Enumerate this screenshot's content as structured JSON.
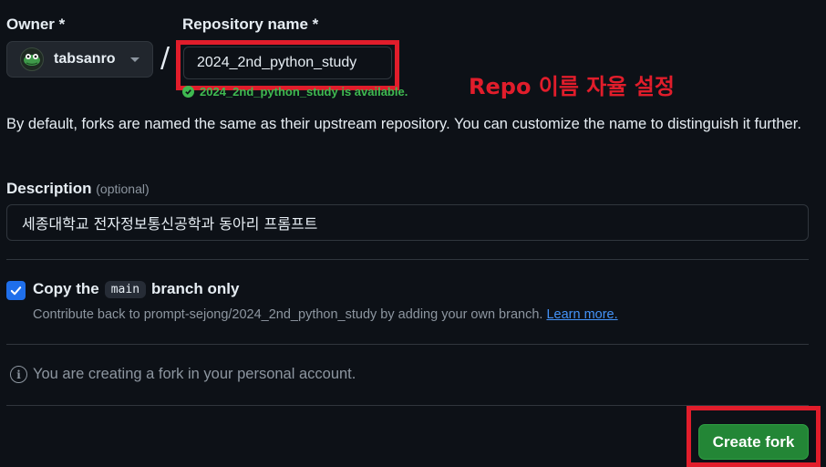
{
  "form": {
    "owner_label": "Owner *",
    "owner_name": "tabsanro",
    "separator": "/",
    "repo_label": "Repository name *",
    "repo_value": "2024_2nd_python_study",
    "availability": "2024_2nd_python_study is available.",
    "hint": "By default, forks are named the same as their upstream repository. You can customize the name to distinguish it further.",
    "description_label": "Description",
    "description_optional": "(optional)",
    "description_value": "세종대학교 전자정보통신공학과 동아리 프롬프트",
    "copy_prefix": "Copy the",
    "copy_branch": "main",
    "copy_suffix": "branch only",
    "contribute_text": "Contribute back to prompt-sejong/2024_2nd_python_study by adding your own branch.",
    "learn_more": "Learn more.",
    "info_text": "You are creating a fork in your personal account.",
    "create_button": "Create fork"
  },
  "annotation": {
    "text": "Repo 이름 자율 설정",
    "color": "#e11d2b"
  },
  "colors": {
    "background": "#0d1117",
    "primary_button": "#238636",
    "checkbox": "#1f6feb",
    "success": "#3fb950",
    "link": "#4493f8"
  },
  "icons": [
    "avatar-icon",
    "caret-down-icon",
    "check-circle-icon",
    "checkmark-icon",
    "info-icon"
  ]
}
